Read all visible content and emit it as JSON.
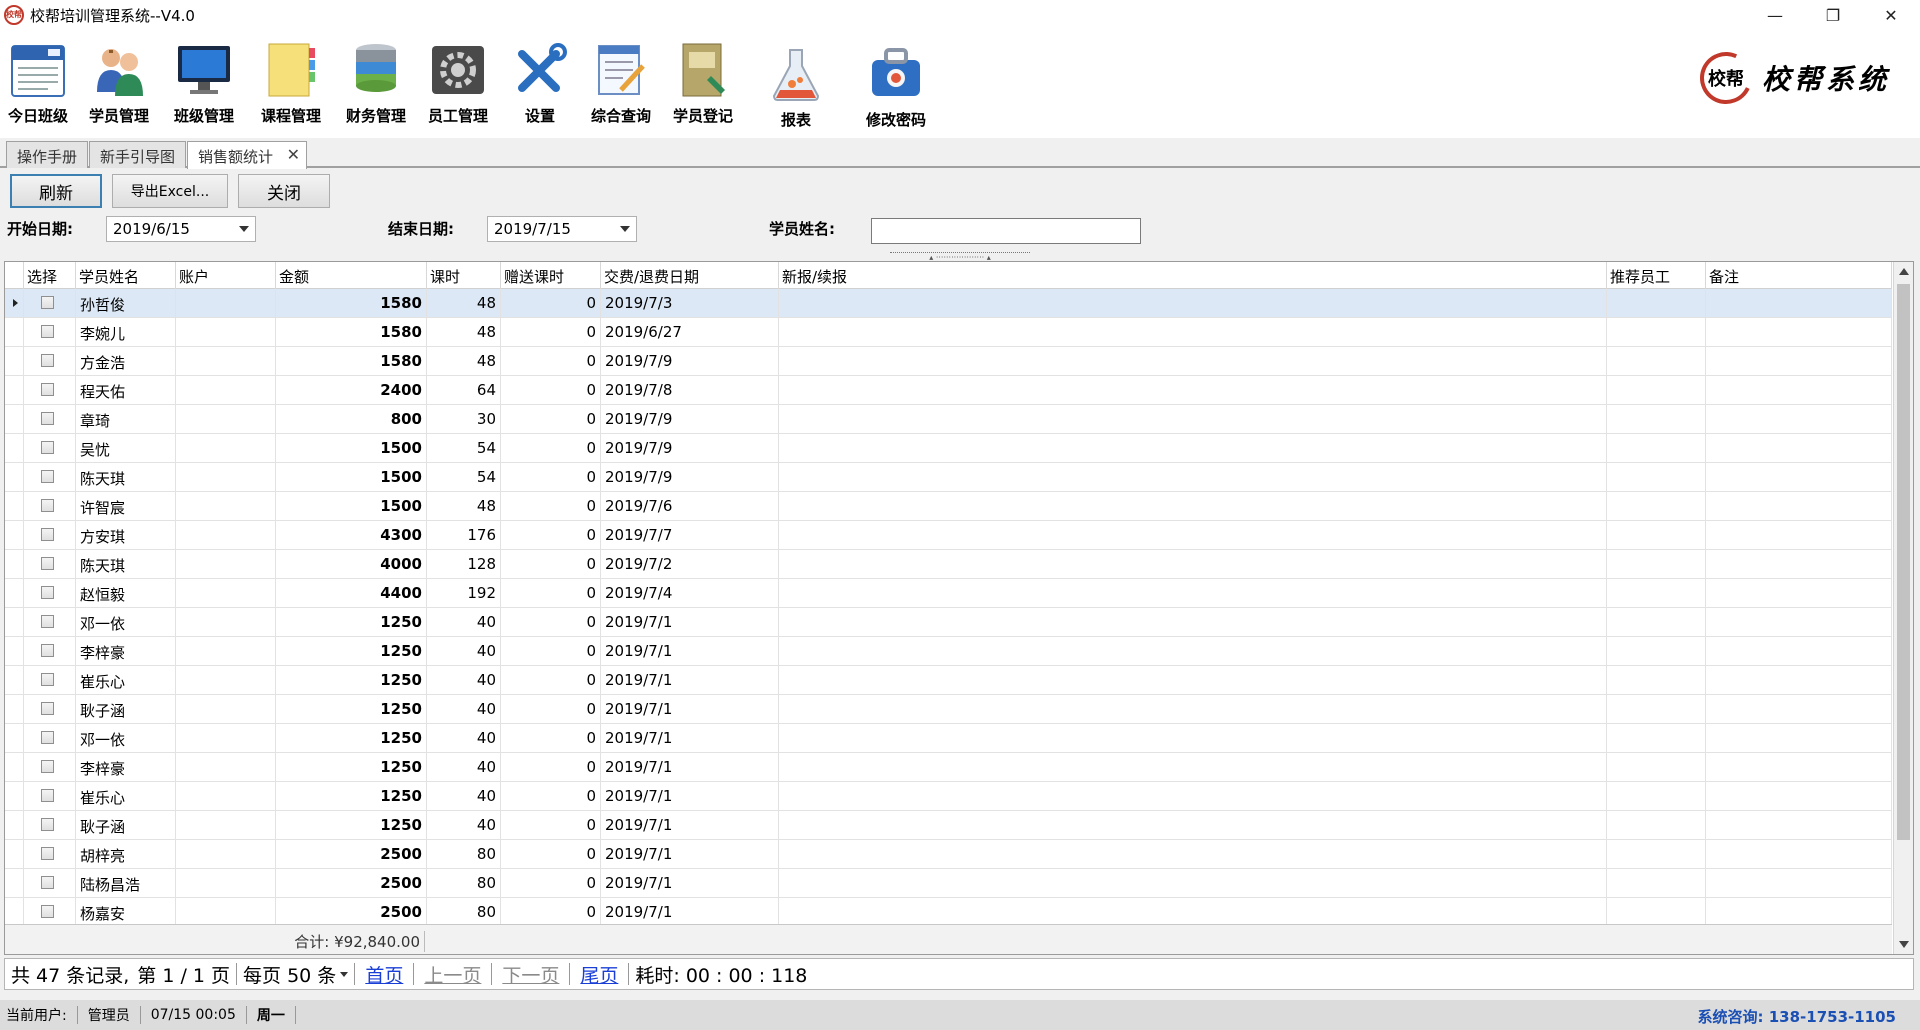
{
  "window": {
    "title": "校帮培训管理系统--V4.0",
    "logo_small": "校帮",
    "minimize": "—",
    "restore": "❐",
    "close": "✕"
  },
  "toolbar": {
    "items": [
      {
        "label": "今日班级",
        "icon": "calendar-icon"
      },
      {
        "label": "学员管理",
        "icon": "people-icon"
      },
      {
        "label": "班级管理",
        "icon": "monitor-icon"
      },
      {
        "label": "课程管理",
        "icon": "notebook-icon"
      },
      {
        "label": "财务管理",
        "icon": "database-icon"
      },
      {
        "label": "员工管理",
        "icon": "gear-icon"
      },
      {
        "label": "设置",
        "icon": "tools-icon"
      },
      {
        "label": "综合查询",
        "icon": "edit-doc-icon"
      },
      {
        "label": "学员登记",
        "icon": "book-icon"
      },
      {
        "label": "报表",
        "icon": "flask-icon"
      },
      {
        "label": "修改密码",
        "icon": "bag-icon"
      }
    ],
    "brand_seal": "校帮",
    "brand_text": "校帮系统"
  },
  "doc_tabs": [
    {
      "label": "操作手册"
    },
    {
      "label": "新手引导图"
    },
    {
      "label": "销售额统计"
    }
  ],
  "doc_tab_close": "✕",
  "actions": {
    "refresh": "刷新",
    "export": "导出Excel...",
    "close": "关闭"
  },
  "filters": {
    "start_label": "开始日期:",
    "start_value": "2019/6/15",
    "end_label": "结束日期:",
    "end_value": "2019/7/15",
    "name_label": "学员姓名:",
    "name_value": ""
  },
  "splitter_glyph": "▴ ··················· ▴",
  "grid": {
    "columns": [
      "选择",
      "学员姓名",
      "账户",
      "金额",
      "课时",
      "赠送课时",
      "交费/退费日期",
      "新报/续报",
      "推荐员工",
      "备注"
    ],
    "rows": [
      {
        "name": "孙哲俊",
        "account": "",
        "amount": "1580",
        "hours": "48",
        "gift": "0",
        "date": "2019/7/3"
      },
      {
        "name": "李婉儿",
        "account": "",
        "amount": "1580",
        "hours": "48",
        "gift": "0",
        "date": "2019/6/27"
      },
      {
        "name": "方金浩",
        "account": "",
        "amount": "1580",
        "hours": "48",
        "gift": "0",
        "date": "2019/7/9"
      },
      {
        "name": "程天佑",
        "account": "",
        "amount": "2400",
        "hours": "64",
        "gift": "0",
        "date": "2019/7/8"
      },
      {
        "name": "章琦",
        "account": "",
        "amount": "800",
        "hours": "30",
        "gift": "0",
        "date": "2019/7/9"
      },
      {
        "name": "吴忧",
        "account": "",
        "amount": "1500",
        "hours": "54",
        "gift": "0",
        "date": "2019/7/9"
      },
      {
        "name": "陈天琪",
        "account": "",
        "amount": "1500",
        "hours": "54",
        "gift": "0",
        "date": "2019/7/9"
      },
      {
        "name": "许智宸",
        "account": "",
        "amount": "1500",
        "hours": "48",
        "gift": "0",
        "date": "2019/7/6"
      },
      {
        "name": "方安琪",
        "account": "",
        "amount": "4300",
        "hours": "176",
        "gift": "0",
        "date": "2019/7/7"
      },
      {
        "name": "陈天琪",
        "account": "",
        "amount": "4000",
        "hours": "128",
        "gift": "0",
        "date": "2019/7/2"
      },
      {
        "name": "赵恒毅",
        "account": "",
        "amount": "4400",
        "hours": "192",
        "gift": "0",
        "date": "2019/7/4"
      },
      {
        "name": "邓一依",
        "account": "",
        "amount": "1250",
        "hours": "40",
        "gift": "0",
        "date": "2019/7/1"
      },
      {
        "name": "李梓豪",
        "account": "",
        "amount": "1250",
        "hours": "40",
        "gift": "0",
        "date": "2019/7/1"
      },
      {
        "name": "崔乐心",
        "account": "",
        "amount": "1250",
        "hours": "40",
        "gift": "0",
        "date": "2019/7/1"
      },
      {
        "name": "耿子涵",
        "account": "",
        "amount": "1250",
        "hours": "40",
        "gift": "0",
        "date": "2019/7/1"
      },
      {
        "name": "邓一依",
        "account": "",
        "amount": "1250",
        "hours": "40",
        "gift": "0",
        "date": "2019/7/1"
      },
      {
        "name": "李梓豪",
        "account": "",
        "amount": "1250",
        "hours": "40",
        "gift": "0",
        "date": "2019/7/1"
      },
      {
        "name": "崔乐心",
        "account": "",
        "amount": "1250",
        "hours": "40",
        "gift": "0",
        "date": "2019/7/1"
      },
      {
        "name": "耿子涵",
        "account": "",
        "amount": "1250",
        "hours": "40",
        "gift": "0",
        "date": "2019/7/1"
      },
      {
        "name": "胡梓亮",
        "account": "",
        "amount": "2500",
        "hours": "80",
        "gift": "0",
        "date": "2019/7/1"
      },
      {
        "name": "陆杨昌浩",
        "account": "",
        "amount": "2500",
        "hours": "80",
        "gift": "0",
        "date": "2019/7/1"
      },
      {
        "name": "杨嘉安",
        "account": "",
        "amount": "2500",
        "hours": "80",
        "gift": "0",
        "date": "2019/7/1"
      }
    ],
    "total": "合计: ¥92,840.00"
  },
  "pager": {
    "records": "共 47 条记录,",
    "page": "第 1 / 1 页",
    "per_page": "每页 50 条",
    "first": "首页",
    "prev": "上一页",
    "next": "下一页",
    "last": "尾页",
    "elapsed": "耗时: 00 : 00 : 118"
  },
  "status": {
    "user_label": "当前用户:",
    "user": "管理员",
    "datetime": "07/15 00:05",
    "weekday": "周一",
    "consult": "系统咨询: 138-1753-1105"
  }
}
